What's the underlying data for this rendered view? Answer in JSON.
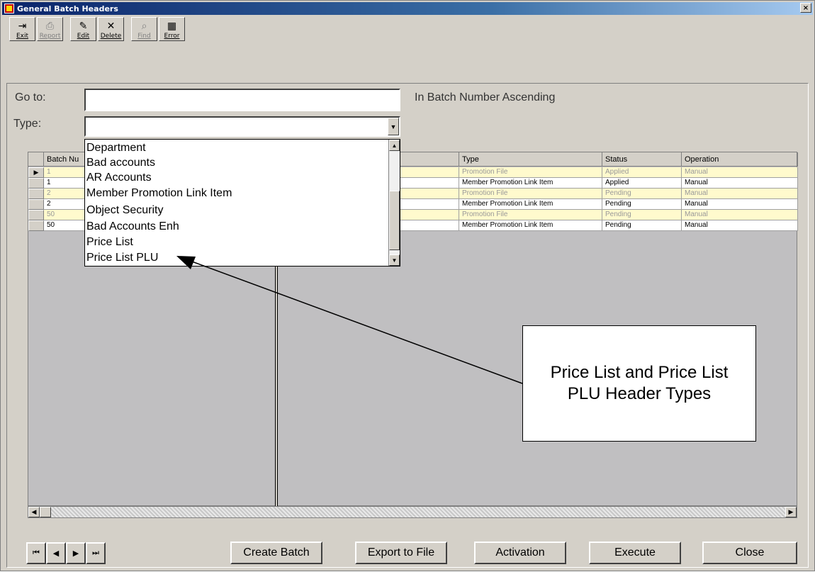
{
  "window": {
    "title": "General Batch Headers",
    "close_glyph": "×"
  },
  "toolbar": {
    "buttons": [
      {
        "label": "Exit",
        "icon": "exit-door-icon",
        "glyph": "⇥",
        "enabled": true
      },
      {
        "label": "Report",
        "icon": "printer-icon",
        "glyph": "⎙",
        "enabled": false
      },
      {
        "label": "Edit",
        "icon": "edit-icon",
        "glyph": "✎",
        "enabled": true
      },
      {
        "label": "Delete",
        "icon": "delete-x-icon",
        "glyph": "✕",
        "enabled": true
      },
      {
        "label": "Find",
        "icon": "binoculars-icon",
        "glyph": "⌕",
        "enabled": false
      },
      {
        "label": "Error",
        "icon": "grid-icon",
        "glyph": "▦",
        "enabled": true
      }
    ]
  },
  "filters": {
    "goto_label": "Go to:",
    "goto_value": "",
    "order_text": "In Batch Number Ascending",
    "type_label": "Type:",
    "type_value": ""
  },
  "type_dropdown": {
    "options": [
      "Department",
      "Bad accounts",
      "AR Accounts",
      "Member Promotion Link Item",
      "Object Security",
      "Bad Accounts Enh",
      "Price List",
      "Price List PLU"
    ]
  },
  "grid": {
    "columns": [
      "Batch Nu",
      "Type",
      "Status",
      "Operation"
    ],
    "rows": [
      {
        "batch": "1",
        "type": "Promotion File",
        "status": "Applied",
        "operation": "Manual",
        "style": "pending",
        "current": true
      },
      {
        "batch": "1",
        "type": "Member Promotion Link Item",
        "status": "Applied",
        "operation": "Manual",
        "style": "plain",
        "current": false
      },
      {
        "batch": "2",
        "type": "Promotion File",
        "status": "Pending",
        "operation": "Manual",
        "style": "pending",
        "current": false
      },
      {
        "batch": "2",
        "type": "Member Promotion Link Item",
        "status": "Pending",
        "operation": "Manual",
        "style": "plain",
        "current": false
      },
      {
        "batch": "50",
        "type": "Promotion File",
        "status": "Pending",
        "operation": "Manual",
        "style": "pending",
        "current": false
      },
      {
        "batch": "50",
        "type": "Member Promotion Link Item",
        "status": "Pending",
        "operation": "Manual",
        "style": "plain",
        "current": false
      }
    ]
  },
  "callout": {
    "text": "Price List and Price List PLU Header Types"
  },
  "nav": {
    "first": "⏮",
    "prev": "◀",
    "next": "▶",
    "last": "⏭"
  },
  "actions": {
    "create_batch": "Create Batch",
    "export_file": "Export to File",
    "activation": "Activation",
    "execute": "Execute",
    "close": "Close"
  },
  "colors": {
    "title_start": "#0a246a",
    "pending_row": "#fffacd",
    "face": "#d4d0c8"
  }
}
